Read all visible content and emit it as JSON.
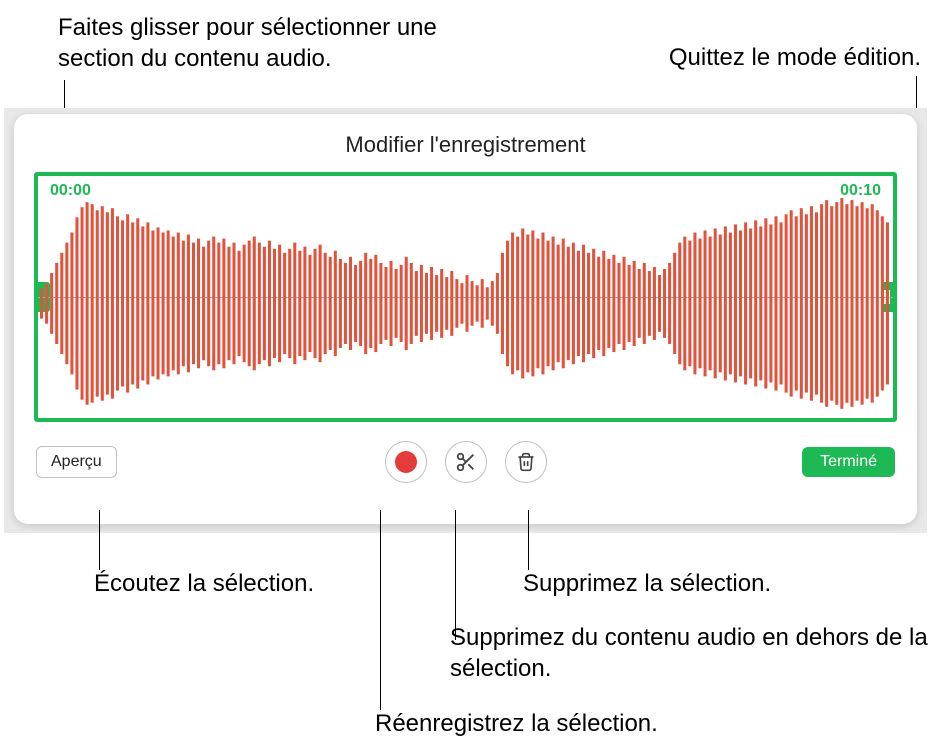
{
  "callouts": {
    "drag_select": "Faites glisser pour sélectionner une section du contenu audio.",
    "exit_edit": "Quittez le mode édition.",
    "listen": "Écoutez la sélection.",
    "delete_selection": "Supprimez la sélection.",
    "delete_outside": "Supprimez du contenu audio en dehors de la sélection.",
    "rerecord": "Réenregistrez la sélection."
  },
  "panel": {
    "title": "Modifier l'enregistrement",
    "time_start": "00:00",
    "time_end": "00:10",
    "preview_label": "Aperçu",
    "done_label": "Terminé"
  },
  "colors": {
    "accent": "#1db954",
    "record": "#e43b3b",
    "waveform": "#e0533c"
  }
}
